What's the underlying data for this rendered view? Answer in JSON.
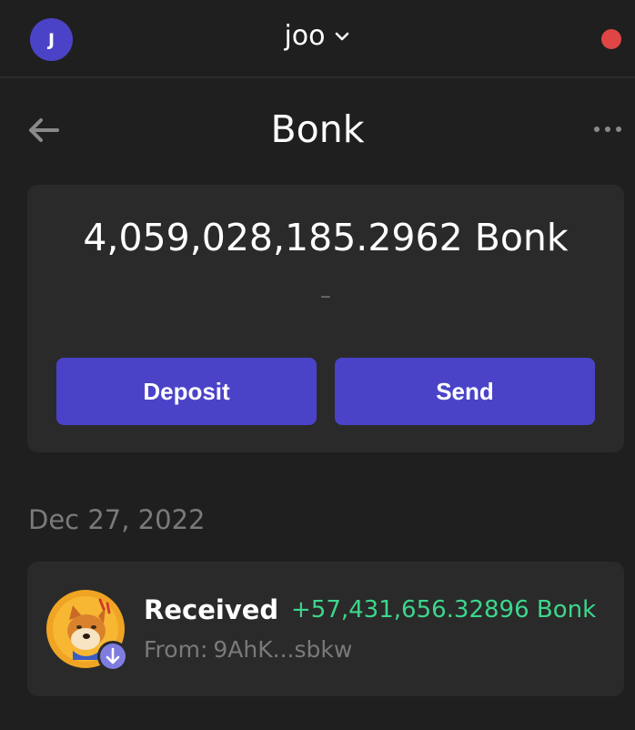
{
  "header": {
    "avatar_initial": "J",
    "wallet_name": "joo",
    "status_color": "#e04545"
  },
  "page": {
    "title": "Bonk",
    "back_icon": "arrow-left-icon",
    "more_icon": "more-horizontal-icon"
  },
  "balance": {
    "amount": "4,059,028,185.2962 Bonk",
    "fiat_value": "–"
  },
  "actions": {
    "deposit_label": "Deposit",
    "send_label": "Send",
    "accent_color": "#4a43c8"
  },
  "activity": {
    "date": "Dec 27, 2022",
    "transactions": [
      {
        "title": "Received",
        "amount": "+57,431,656.32896 Bonk",
        "from_label": "From:",
        "from_address": "9AhK...sbkw",
        "icon": "bonk-token-icon",
        "badge_icon": "arrow-down-icon",
        "amount_color": "#3dd68c"
      }
    ]
  }
}
